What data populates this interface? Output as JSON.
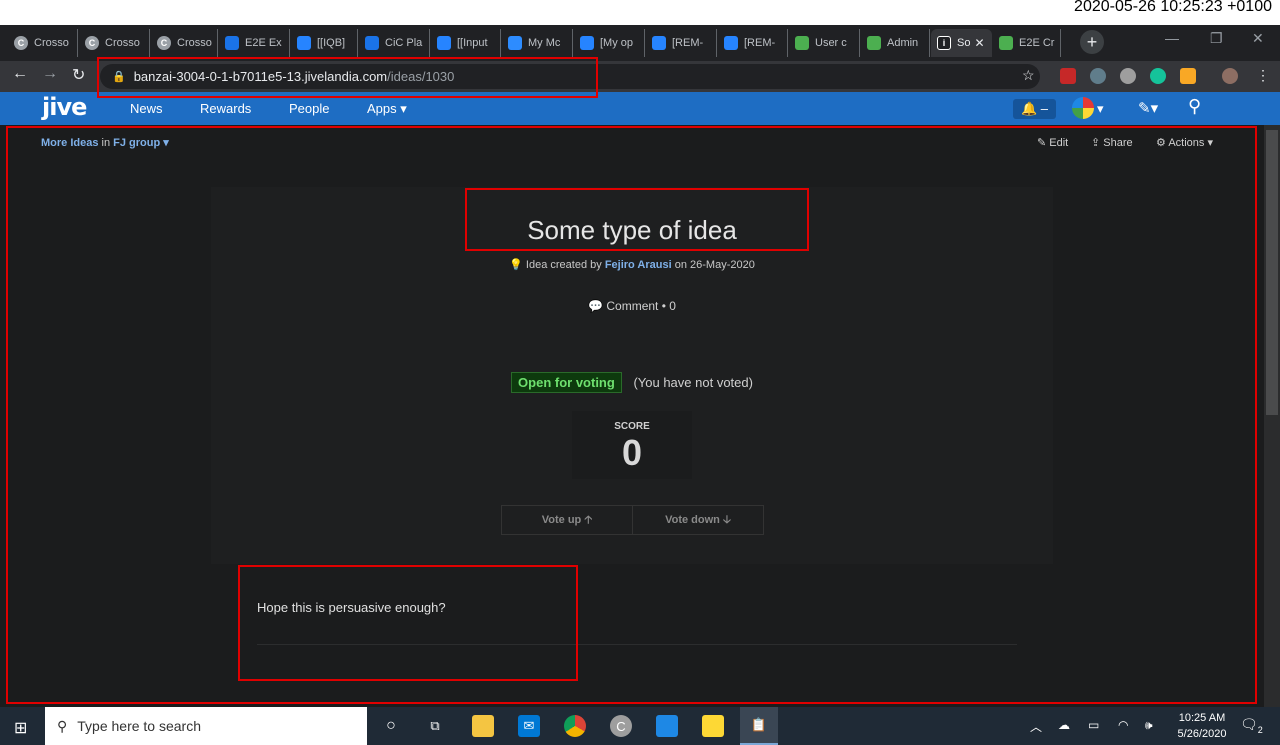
{
  "timestamp": "2020-05-26 10:25:23 +0100",
  "tabs": [
    {
      "label": "Crosso",
      "icon": "c-circle-icon",
      "color": "#9aa0a6"
    },
    {
      "label": "Crosso",
      "icon": "c-circle-icon",
      "color": "#9aa0a6"
    },
    {
      "label": "Crosso",
      "icon": "c-circle-icon",
      "color": "#9aa0a6"
    },
    {
      "label": "E2E Ex",
      "icon": "x-icon",
      "color": "#1a73e8"
    },
    {
      "label": "[[IQB]",
      "icon": "diamond-icon",
      "color": "#2684ff"
    },
    {
      "label": "CiC Pla",
      "icon": "x-icon",
      "color": "#1a73e8"
    },
    {
      "label": "[[Input",
      "icon": "diamond-icon",
      "color": "#2684ff"
    },
    {
      "label": "My Mc",
      "icon": "zoom-icon",
      "color": "#2d8cff"
    },
    {
      "label": "[My op",
      "icon": "diamond-icon",
      "color": "#2684ff"
    },
    {
      "label": "[REM-",
      "icon": "diamond-icon",
      "color": "#2684ff"
    },
    {
      "label": "[REM-",
      "icon": "diamond-icon",
      "color": "#2684ff"
    },
    {
      "label": "User c",
      "icon": "bar-chart-icon",
      "color": "#4caf50"
    },
    {
      "label": "Admin",
      "icon": "bar-chart-icon",
      "color": "#4caf50"
    },
    {
      "label": "So",
      "icon": "jive-icon",
      "color": "#ffffff",
      "active": true
    },
    {
      "label": "E2E Cr",
      "icon": "bar-chart-icon",
      "color": "#4caf50"
    }
  ],
  "browser": {
    "url_host": "banzai-3004-0-1-b7011e5-13.jivelandia.com",
    "url_path": "/ideas/1030"
  },
  "jive": {
    "logo": "jive",
    "nav": [
      "News",
      "Rewards",
      "People",
      "Apps"
    ]
  },
  "subbar": {
    "crumb_link": "More Ideas",
    "crumb_in": "in",
    "crumb_group": "FJ group",
    "edit": "Edit",
    "share": "Share",
    "actions": "Actions"
  },
  "idea": {
    "title": "Some type of idea",
    "meta_prefix": "Idea created by",
    "author": "Fejiro Arausi",
    "meta_suffix": "on 26-May-2020",
    "comment_label": "Comment",
    "comment_count": "0",
    "status": "Open for voting",
    "vote_note": "(You have not voted)",
    "score_label": "SCORE",
    "score_value": "0",
    "vote_up": "Vote up",
    "vote_down": "Vote down",
    "body": "Hope this is persuasive enough?"
  },
  "taskbar": {
    "search_placeholder": "Type here to search",
    "time": "10:25 AM",
    "date": "5/26/2020",
    "notifications": "2"
  },
  "colors": {
    "jive_blue": "#1e6dc3",
    "highlight_red": "#e00000",
    "open_badge": "#0d3a0d"
  }
}
